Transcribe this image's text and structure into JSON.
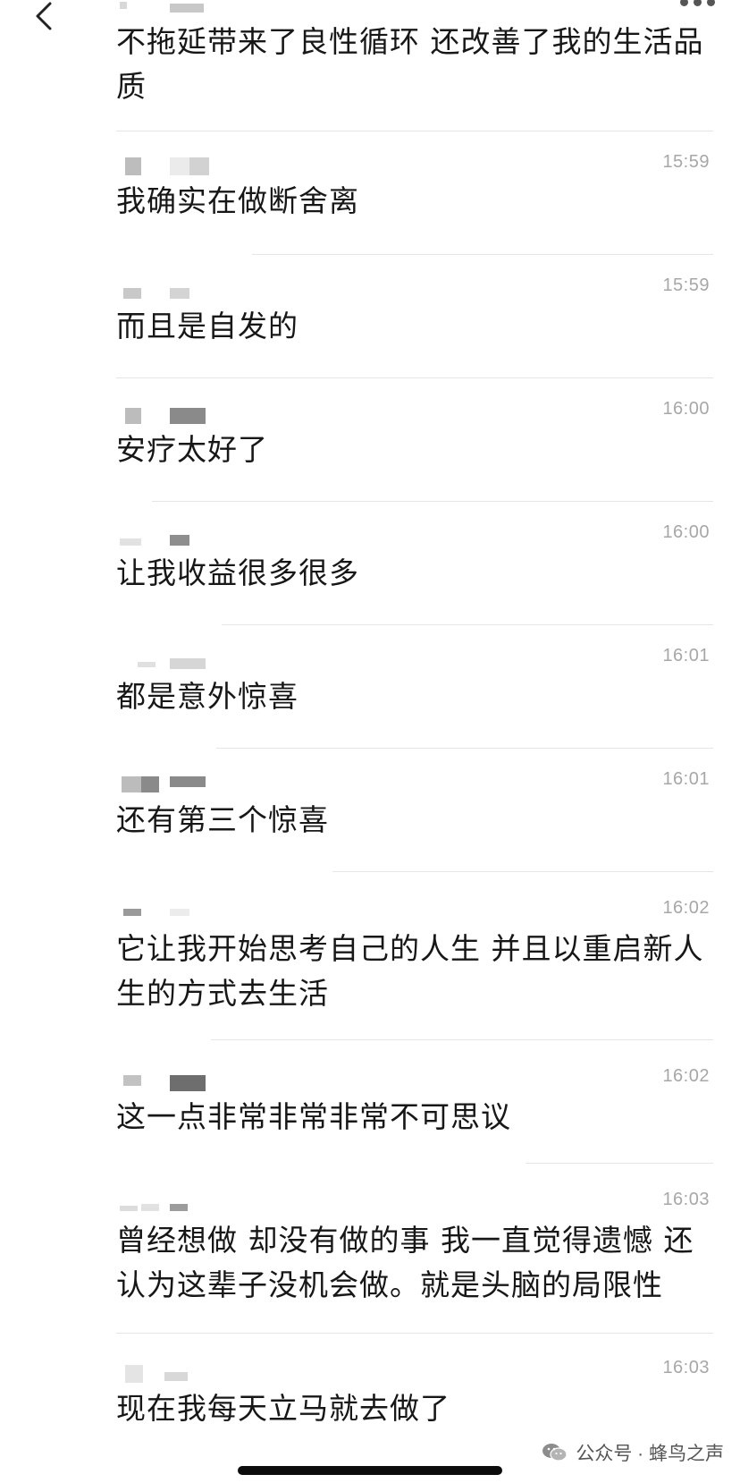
{
  "messages": [
    {
      "text": "不拖延带来了良性循环 还改善了我的生活品质",
      "time": ""
    },
    {
      "text": "我确实在做断舍离",
      "time": "15:59"
    },
    {
      "text": "而且是自发的",
      "time": "15:59"
    },
    {
      "text": "安疗太好了",
      "time": "16:00"
    },
    {
      "text": "让我收益很多很多",
      "time": "16:00"
    },
    {
      "text": "都是意外惊喜",
      "time": "16:01"
    },
    {
      "text": "还有第三个惊喜",
      "time": "16:01"
    },
    {
      "text": "它让我开始思考自己的人生 并且以重启新人生的方式去生活",
      "time": "16:02"
    },
    {
      "text": "这一点非常非常非常不可思议",
      "time": "16:02"
    },
    {
      "text": "曾经想做 却没有做的事 我一直觉得遗憾 还认为这辈子没机会做。就是头脑的局限性",
      "time": "16:03"
    },
    {
      "text": "现在我每天立马就去做了",
      "time": "16:03"
    }
  ],
  "watermark": {
    "text": "公众号 · 蜂鸟之声"
  },
  "icons": {
    "back": "chevron-left-icon",
    "more": "more-dots-icon",
    "watermark": "wechat-icon"
  }
}
